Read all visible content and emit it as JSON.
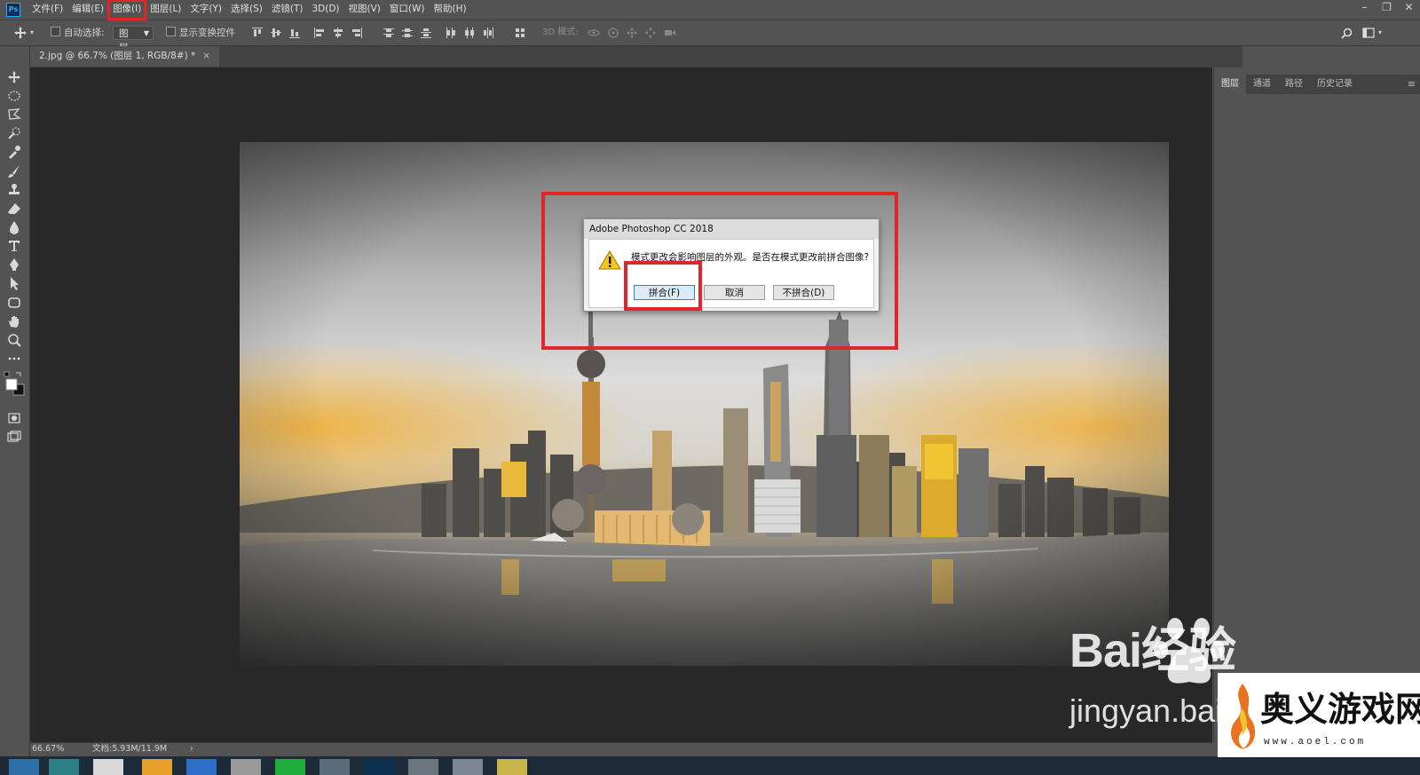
{
  "app": {
    "logo": "Ps"
  },
  "menu": [
    "文件(F)",
    "编辑(E)",
    "图像(I)",
    "图层(L)",
    "文字(Y)",
    "选择(S)",
    "滤镜(T)",
    "3D(D)",
    "视图(V)",
    "窗口(W)",
    "帮助(H)"
  ],
  "menu_active_index": 2,
  "window_controls": {
    "minimize": "–",
    "restore": "❐",
    "close": "✕"
  },
  "options": {
    "auto_select_label": "自动选择:",
    "auto_select_value": "图层",
    "show_transform_label": "显示变换控件",
    "mode_3d_label": "3D 模式:"
  },
  "document_tab": {
    "title": "2.jpg @ 66.7% (图层 1, RGB/8#) *",
    "close": "×"
  },
  "panels": {
    "tabs": [
      "图层",
      "通道",
      "路径",
      "历史记录"
    ],
    "active": 0,
    "menu_icon": "≡"
  },
  "dialog": {
    "title": "Adobe Photoshop CC 2018",
    "message": "模式更改会影响图层的外观。是否在模式更改前拼合图像?",
    "buttons": {
      "flatten": "拼合(F)",
      "cancel": "取消",
      "dont_flatten": "不拼合(D)"
    }
  },
  "status": {
    "zoom": "66.67%",
    "doc_info": "文档:5.93M/11.9M",
    "arrow": "›"
  },
  "watermarks": {
    "baidu": "Bai经验",
    "jingyan": "jingyan.bai",
    "aoel_name": "奥义游戏网",
    "aoel_url": "www.aoel.com"
  },
  "colors": {
    "highlight": "#e1262b",
    "ui_bg": "#535353",
    "accent_gold": "#f0b429"
  }
}
